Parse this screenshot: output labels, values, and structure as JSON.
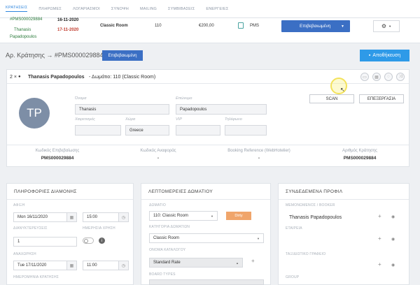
{
  "nav": {
    "tabs": [
      "ΚΡΑΤΗΣΕΙΣ",
      "ΠΛΗΡΩΜΕΣ",
      "ΛΟΓΑΡΙΑΣΜΟΙ",
      "ΣΥΝΟΨΗ",
      "MAILING",
      "ΣΥΜΒΙΒΑΣΕΙΣ",
      "ΕΝΕΡΓΕΙΕΣ"
    ]
  },
  "top_row": {
    "ref_partial": "#PMS000029884",
    "guest_first": "Thanasis",
    "guest_last": "Papadopoulos",
    "date_from": "16-11-2020",
    "date_to": "17-11-2020",
    "room_type": "Classic Room",
    "room_no": "110",
    "amount": "€200,00",
    "channel": "PMS",
    "status": "Επιβεβαιωμένη"
  },
  "header": {
    "title": "Αρ. Κράτησης → #PMS000029884",
    "status_badge": "Επιβεβαιωμένη",
    "save_label": "Αποθήκευση"
  },
  "guest": {
    "count": "2 ×",
    "name": "Thanasis Papadopoulos",
    "room_info": "- Δωμάτιο: 110 (Classic Room)",
    "initials": "TP",
    "first_name_label": "Όνομα",
    "first_name": "Thanasis",
    "last_name_label": "Επώνυμο",
    "last_name": "Papadopoulos",
    "greeting_label": "Χαιρετισμός",
    "country_label": "Χώρα",
    "country": "Greece",
    "vip_label": "VIP",
    "phone_label": "Τηλέφωνο",
    "scan_label": "SCAN",
    "edit_label": "ΕΠΕΞΕΡΓΑΣΙΑ"
  },
  "refs": [
    {
      "label": "Κωδικός Επιβεβαίωσης",
      "value": "PMS000029884"
    },
    {
      "label": "Κωδικός Αναφοράς",
      "value": "-"
    },
    {
      "label": "Booking Reference (WebHotelier)",
      "value": "-"
    },
    {
      "label": "Αριθμός Κράτησης",
      "value": "PMS000029884"
    }
  ],
  "stay": {
    "title": "ΠΛΗΡΟΦΟΡΙΕΣ ΔΙΑΜΟΝΗΣ",
    "arrival_label": "ΑΦΙΞΗ",
    "arrival_date": "Mon 16/11/2020",
    "arrival_time": "15:00",
    "nights_label": "ΔΙΑΝΥΚΤΕΡΕΥΣΕΙΣ",
    "nights": "1",
    "dayuse_label": "ΗΜΕΡΗΣΙΑ ΧΡΗΣΗ",
    "departure_label": "ΑΝΑΧΩΡΗΣΗ",
    "departure_date": "Tue 17/11/2020",
    "departure_time": "11:00",
    "booking_date_label": "ΗΜΕΡΟΜΗΝΙΑ ΚΡΑΤΗΣΗΣ"
  },
  "room": {
    "title": "ΛΕΠΤΟΜΕΡΕΙΕΣ ΔΩΜΑΤΙΟΥ",
    "room_label": "ΔΩΜΑΤΙΟ",
    "room_value": "110: Classic Room",
    "dirty_label": "Dirty",
    "category_label": "ΚΑΤΗΓΟΡΙΑ ΔΩΜΑΤΙΩΝ",
    "category_value": "Classic Room",
    "rate_label": "ΟΝΟΜΑ ΚΑΤΑΛΟΓΟΥ",
    "rate_value": "Standard Rate",
    "board_label": "BOARD TYPES"
  },
  "profiles": {
    "title": "ΣΥΝΔΕΔΕΜΕΝΑ ΠΡΟΦΙΛ",
    "booker_label": "ΜΕΜΟΝΩΜΕΝΟΣ / BOOKER",
    "booker_value": "Thanasis Papadopoulos",
    "company_label": "ΕΤΑΙΡΕΙΑ",
    "agency_label": "ΤΑΞΙΔΙΩΤΙΚΟ ΓΡΑΦΕΙΟ",
    "group_label": "GROUP"
  }
}
